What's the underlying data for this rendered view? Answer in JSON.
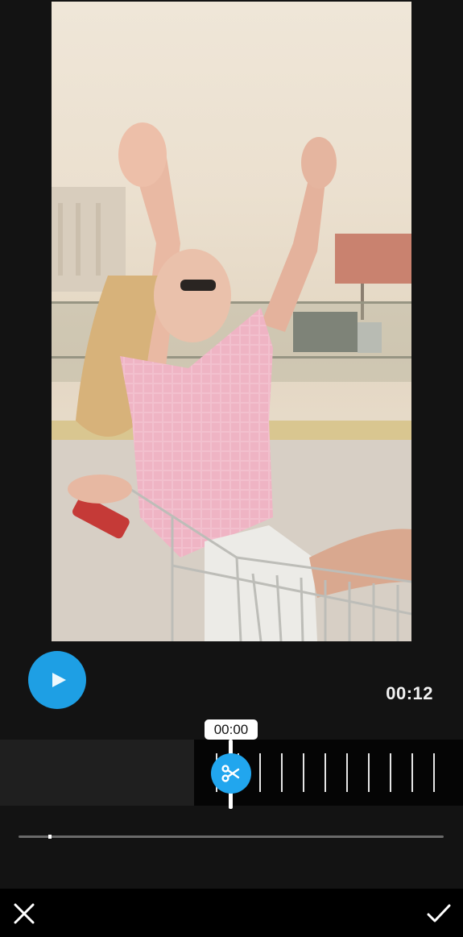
{
  "player": {
    "play_icon": "play-icon",
    "accent_color": "#1e9fe4",
    "duration_label": "00:12"
  },
  "trimmer": {
    "current_time_label": "00:00",
    "handle_icon": "scissors-icon",
    "tick_count": 11,
    "scrub_progress": 0.07
  },
  "bottom_bar": {
    "cancel_icon": "close-icon",
    "confirm_icon": "check-icon"
  }
}
